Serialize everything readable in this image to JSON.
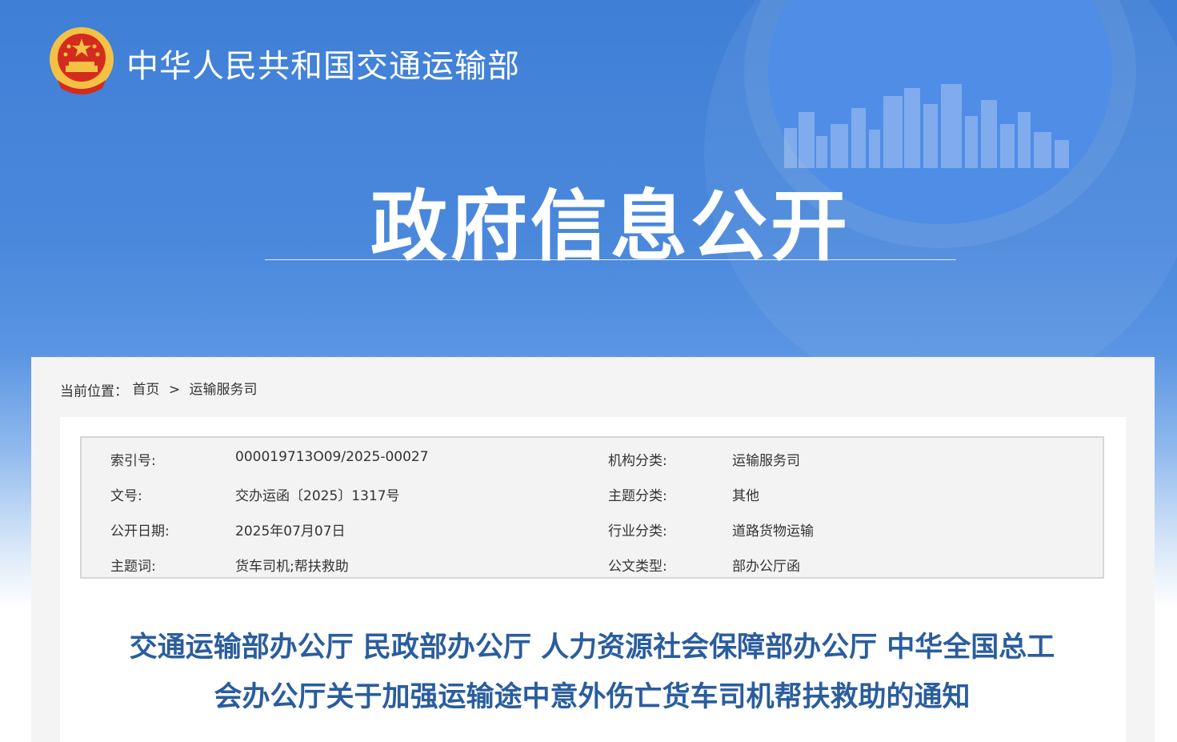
{
  "header": {
    "site_title": "中华人民共和国交通运输部",
    "banner_title": "政府信息公开"
  },
  "breadcrumb": {
    "label": "当前位置：",
    "items": [
      "首页",
      "运输服务司"
    ],
    "separator": ">"
  },
  "meta": {
    "rows": [
      {
        "k1": "索引号:",
        "v1": "000019713O09/2025-00027",
        "k2": "机构分类:",
        "v2": "运输服务司"
      },
      {
        "k1": "文号:",
        "v1": "交办运函〔2025〕1317号",
        "k2": "主题分类:",
        "v2": "其他"
      },
      {
        "k1": "公开日期:",
        "v1": "2025年07月07日",
        "k2": "行业分类:",
        "v2": "道路货物运输"
      },
      {
        "k1": "主题词:",
        "v1": "货车司机;帮扶救助",
        "k2": "公文类型:",
        "v2": "部办公厅函"
      }
    ]
  },
  "document": {
    "title_line1": "交通运输部办公厅 民政部办公厅 人力资源社会保障部办公厅 中华全国总工",
    "title_line2": "会办公厅关于加强运输途中意外伤亡货车司机帮扶救助的通知"
  },
  "colors": {
    "banner_blue": "#3f7fd6",
    "title_blue": "#2a5d9e",
    "emblem_red": "#d52b1e",
    "emblem_gold": "#f3c244"
  }
}
